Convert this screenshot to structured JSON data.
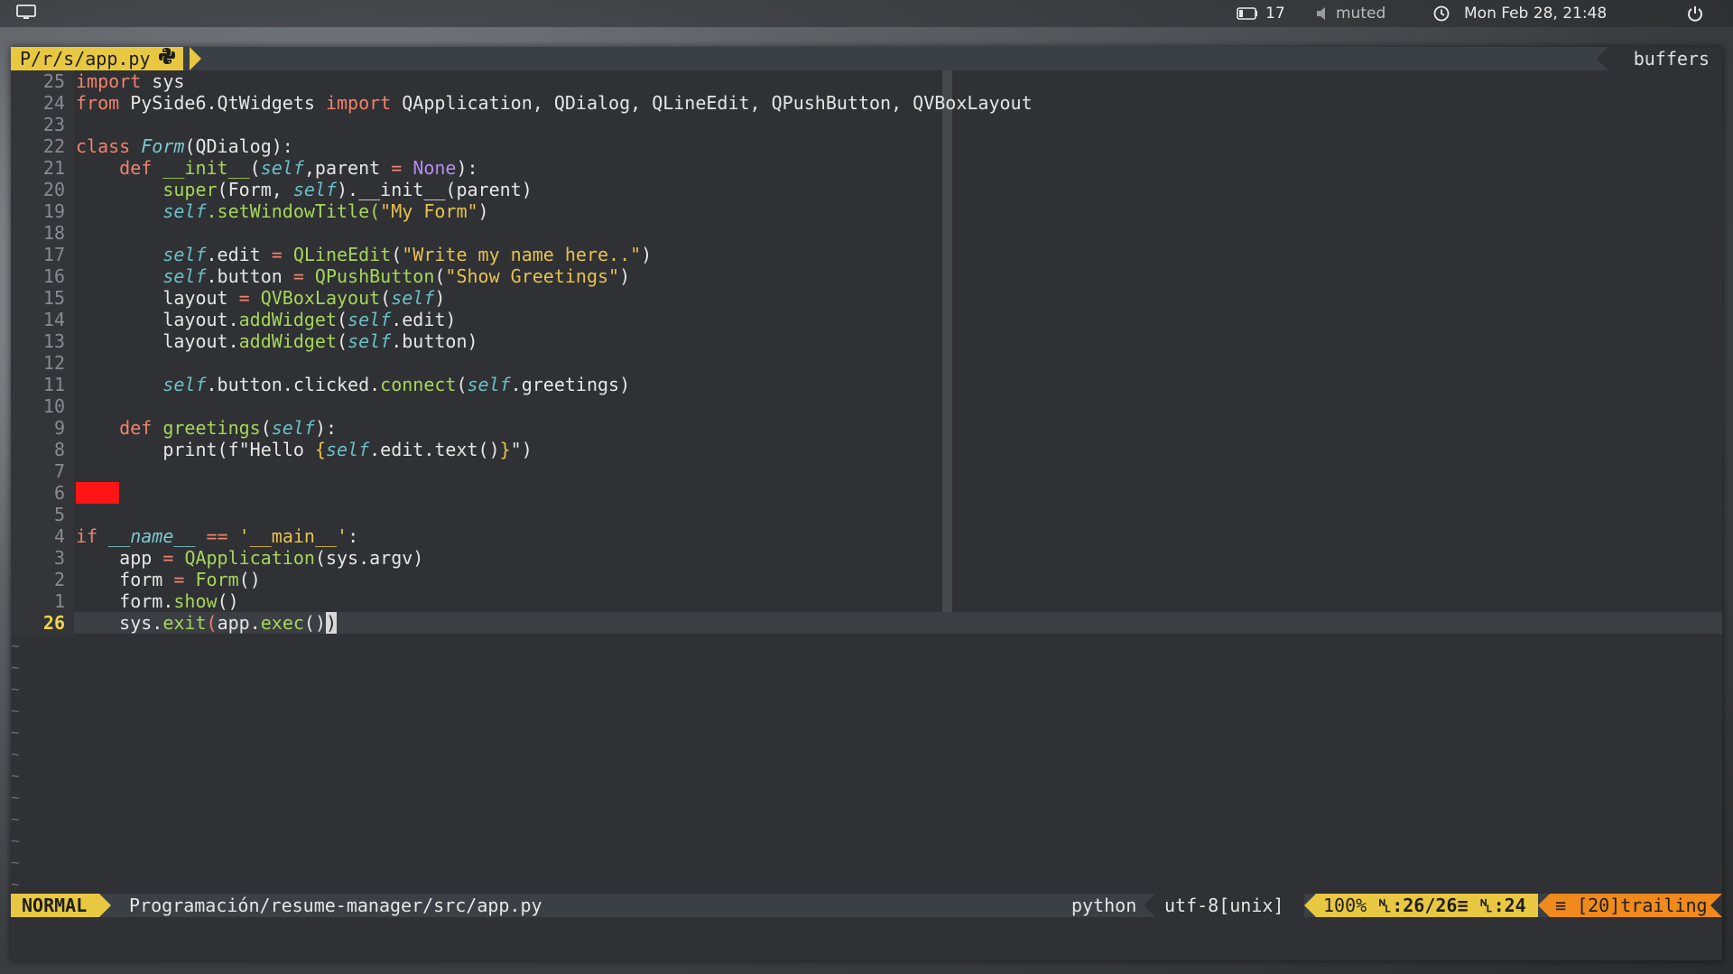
{
  "topbar": {
    "battery": "17",
    "volume": "muted",
    "datetime": "Mon Feb 28, 21:48"
  },
  "tabline": {
    "active_tab": "P/r/s/app.py",
    "right_label": "buffers"
  },
  "editor": {
    "current_line_number": "26",
    "lines": [
      "25",
      "24",
      "23",
      "22",
      "21",
      "20",
      "19",
      "18",
      "17",
      "16",
      "15",
      "14",
      "13",
      "12",
      "11",
      "10",
      "9",
      "8",
      "7",
      "6",
      "5",
      "4",
      "3",
      "2",
      "1"
    ]
  },
  "code": {
    "import": "import",
    "sys": " sys",
    "from": "from",
    "module": " PySide6.QtWidgets ",
    "import2": "import",
    "imports_list": " QApplication, QDialog, QLineEdit, QPushButton, QVBoxLayout",
    "class": "class",
    "form_cls": "Form",
    "form_base": "(QDialog):",
    "def": "def",
    "init": "__init__",
    "p_open": "(",
    "self": "self",
    "parent_kw": ",parent ",
    "eq": "=",
    "none": "None",
    "close_colon": "):",
    "super": "super",
    "super_args_a": "(Form, ",
    "super_args_b": ").__init__(parent)",
    "set_title": ".setWindowTitle(",
    "title_str": "\"My Form\"",
    "close": ")",
    "edit_attr": ".edit ",
    "qlineedit": "QLineEdit",
    "edit_str": "\"Write my name here..\"",
    "button_attr": ".button ",
    "qpushbutton": "QPushButton",
    "button_str": "\"Show Greetings\"",
    "layout": "layout ",
    "qvboxlayout": "QVBoxLayout",
    "layout_dot": "layout.",
    "addwidget": "addWidget",
    "edit_close": ".edit)",
    "button_close": ".button)",
    "clicked": ".button.clicked.",
    "connect": "connect",
    "greet_close": ".greetings)",
    "greetings": "greetings",
    "colon_close": "):",
    "print": "print(f\"Hello ",
    "brace_open": "{",
    "print_mid": ".edit.text()",
    "brace_close": "}",
    "print_end": "\")",
    "if": "if",
    "dunder_name": "__name__",
    "eqeq": "==",
    "main_str": "'__main__'",
    "colon": ":",
    "app": "app ",
    "qapplication": "QApplication",
    "argv": "(sys.argv)",
    "form_var": "form ",
    "form_call": "Form",
    "parens": "()",
    "form_dot": "form.",
    "show": "show",
    "sys_dot": "sys.",
    "exit": "exit",
    "paren_hl": "(",
    "app_dot": "app.",
    "exec": "exec",
    "exec_parens": "()",
    "cursor_char": ")"
  },
  "statusline": {
    "mode": "NORMAL",
    "file_path": "Programación/resume-manager/src/app.py",
    "filetype": "python",
    "encoding": "utf-8[unix]",
    "percent": "100%",
    "position": ":26/26≡",
    "column": ":24",
    "warning": "≡ [20]trailing"
  },
  "colors": {
    "accent": "#e8c841",
    "warning": "#f08a1c",
    "error_mark": "#ff1515"
  }
}
